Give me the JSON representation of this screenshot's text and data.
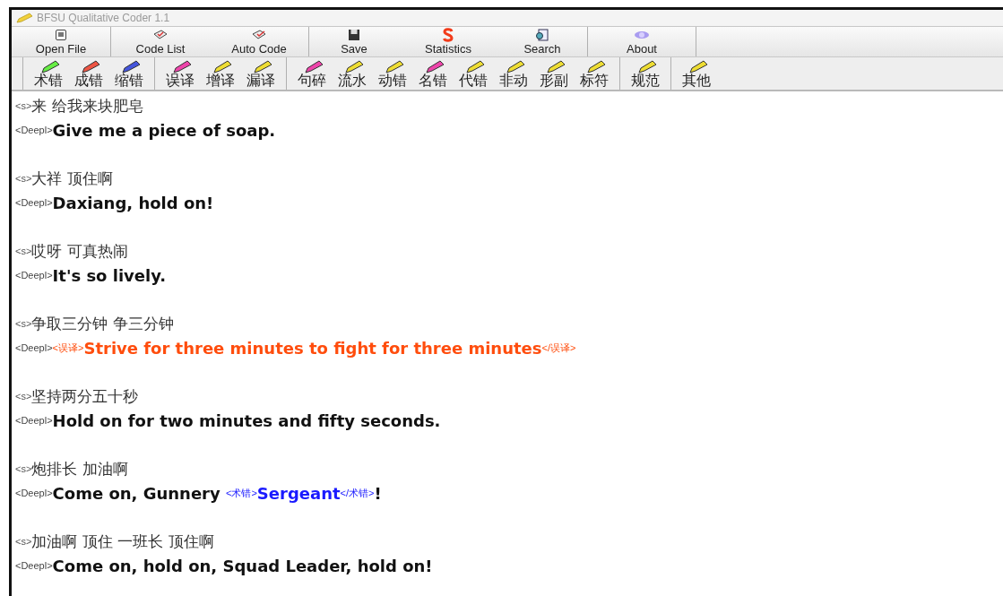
{
  "window": {
    "title": "BFSU Qualitative Coder 1.1"
  },
  "toolbar": [
    [
      {
        "label": "Open File"
      }
    ],
    [
      {
        "label": "Code List"
      },
      {
        "label": "Auto Code"
      }
    ],
    [
      {
        "label": "Save"
      },
      {
        "label": "Statistics"
      },
      {
        "label": "Search"
      }
    ],
    [
      {
        "label": "About"
      }
    ]
  ],
  "code_toolbar": [
    [
      {
        "label": "术错",
        "color": "#66ee44"
      },
      {
        "label": "成错",
        "color": "#ee5544"
      },
      {
        "label": "缩错",
        "color": "#4455dd"
      }
    ],
    [
      {
        "label": "误译",
        "color": "#ee44aa"
      },
      {
        "label": "增译",
        "color": "#eedd33"
      },
      {
        "label": "漏译",
        "color": "#eedd33"
      }
    ],
    [
      {
        "label": "句碎",
        "color": "#ee44aa"
      },
      {
        "label": "流水",
        "color": "#eedd33"
      },
      {
        "label": "动错",
        "color": "#eedd33"
      },
      {
        "label": "名错",
        "color": "#ee44aa"
      },
      {
        "label": "代错",
        "color": "#eedd33"
      },
      {
        "label": "非动",
        "color": "#eedd33"
      },
      {
        "label": "形副",
        "color": "#eedd33"
      },
      {
        "label": "标符",
        "color": "#eedd33"
      }
    ],
    [
      {
        "label": "规范",
        "color": "#eedd33"
      }
    ],
    [
      {
        "label": "其他",
        "color": "#eedd33"
      }
    ]
  ],
  "entries": [
    {
      "source_tag": "<s>",
      "source": "来 给我来块肥皂",
      "target_tag": "<Deepl>",
      "target": [
        {
          "kind": "text",
          "text": "Give me a piece of soap."
        }
      ]
    },
    {
      "source_tag": "<s>",
      "source": "大祥 顶住啊",
      "target_tag": "<Deepl>",
      "target": [
        {
          "kind": "text",
          "text": "Daxiang, hold on!"
        }
      ]
    },
    {
      "source_tag": "<s>",
      "source": "哎呀 可真热闹",
      "target_tag": "<Deepl>",
      "target": [
        {
          "kind": "text",
          "text": "It's so lively."
        }
      ]
    },
    {
      "source_tag": "<s>",
      "source": "争取三分钟 争三分钟",
      "target_tag": "<Deepl>",
      "target": [
        {
          "kind": "code",
          "open": "<误译>",
          "text": "Strive for three minutes to fight for three minutes",
          "close": "</误译>",
          "color": "#ff4d0d"
        }
      ]
    },
    {
      "source_tag": "<s>",
      "source": "坚持两分五十秒",
      "target_tag": "<Deepl>",
      "target": [
        {
          "kind": "text",
          "text": "Hold on for two minutes and fifty seconds."
        }
      ]
    },
    {
      "source_tag": "<s>",
      "source": "炮排长 加油啊",
      "target_tag": "<Deepl>",
      "target": [
        {
          "kind": "text",
          "text": "Come on, Gunnery "
        },
        {
          "kind": "code",
          "open": "<术错>",
          "text": "Sergeant",
          "close": "</术错>",
          "color": "#1a1aff"
        },
        {
          "kind": "text",
          "text": "!"
        }
      ]
    },
    {
      "source_tag": "<s>",
      "source": "加油啊 顶住 一班长 顶住啊",
      "target_tag": "<Deepl>",
      "target": [
        {
          "kind": "text",
          "text": "Come on, hold on, Squad Leader, hold on!"
        }
      ]
    }
  ]
}
